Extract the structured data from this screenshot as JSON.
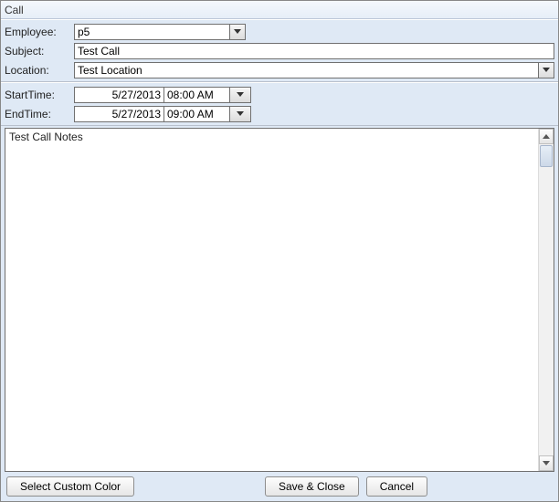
{
  "window": {
    "title": "Call"
  },
  "labels": {
    "employee": "Employee:",
    "subject": "Subject:",
    "location": "Location:",
    "starttime": "StartTime:",
    "endtime": "EndTime:"
  },
  "fields": {
    "employee": "p5",
    "subject": "Test Call",
    "location": "Test Location",
    "start_date": "5/27/2013",
    "start_time": "08:00 AM",
    "end_date": "5/27/2013",
    "end_time": "09:00 AM",
    "notes": "Test Call Notes"
  },
  "buttons": {
    "custom_color": "Select Custom Color",
    "save_close": "Save & Close",
    "cancel": "Cancel"
  }
}
